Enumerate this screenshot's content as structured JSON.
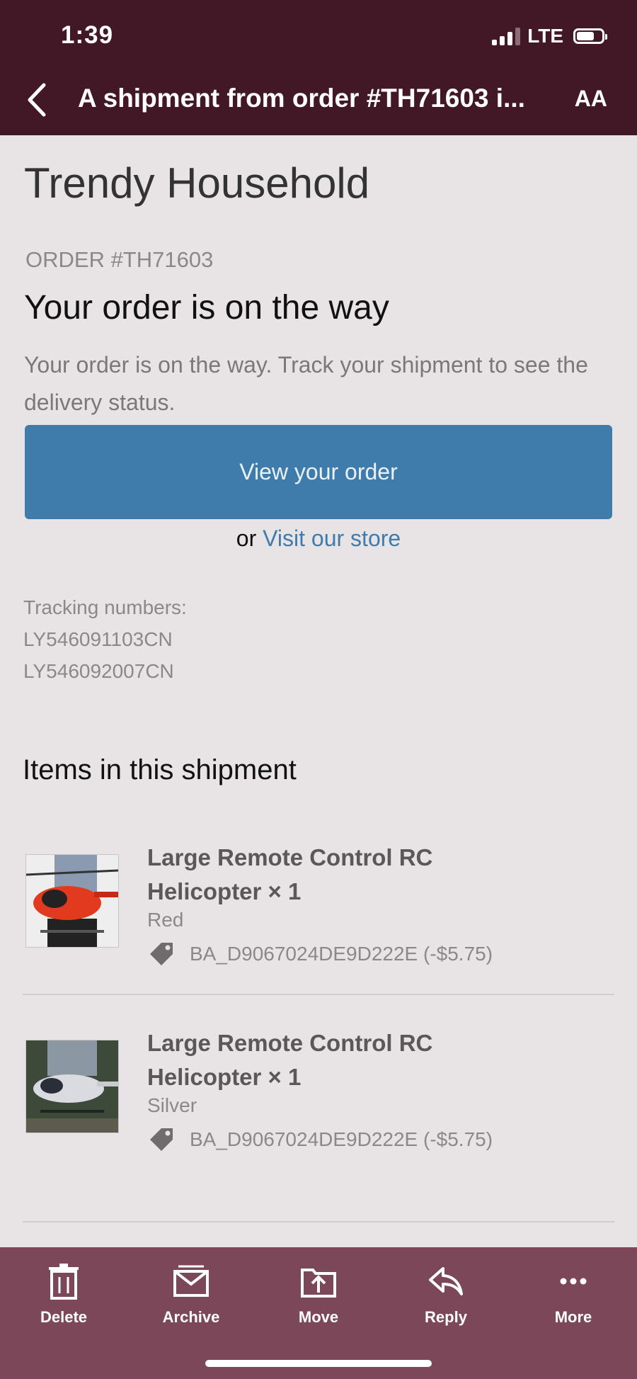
{
  "status_bar": {
    "time": "1:39",
    "network": "LTE"
  },
  "header": {
    "title": "A shipment from order #TH71603 i...",
    "text_size_label": "AA"
  },
  "email": {
    "store_name": "Trendy Household",
    "order_number": "ORDER #TH71603",
    "headline": "Your order is on the way",
    "description": "Your order is on the way. Track your shipment to see the delivery status.",
    "view_order_button": "View your order",
    "or_text": "or",
    "visit_store_link": "Visit our store",
    "tracking_label": "Tracking numbers:",
    "tracking_numbers": [
      "LY546091103CN",
      "LY546092007CN"
    ],
    "items_heading": "Items in this shipment",
    "items": [
      {
        "name_line1": "Large Remote Control RC",
        "name_line2": "Helicopter × 1",
        "variant": "Red",
        "discount": "BA_D9067024DE9D222E (-$5.75)"
      },
      {
        "name_line1": "Large Remote Control RC",
        "name_line2": "Helicopter × 1",
        "variant": "Silver",
        "discount": "BA_D9067024DE9D222E (-$5.75)"
      }
    ]
  },
  "toolbar": {
    "delete": "Delete",
    "archive": "Archive",
    "move": "Move",
    "reply": "Reply",
    "more": "More"
  },
  "colors": {
    "header_bg": "#421826",
    "toolbar_bg": "#7b4759",
    "button_blue": "#3f7cac",
    "page_bg": "#e8e4e6"
  }
}
